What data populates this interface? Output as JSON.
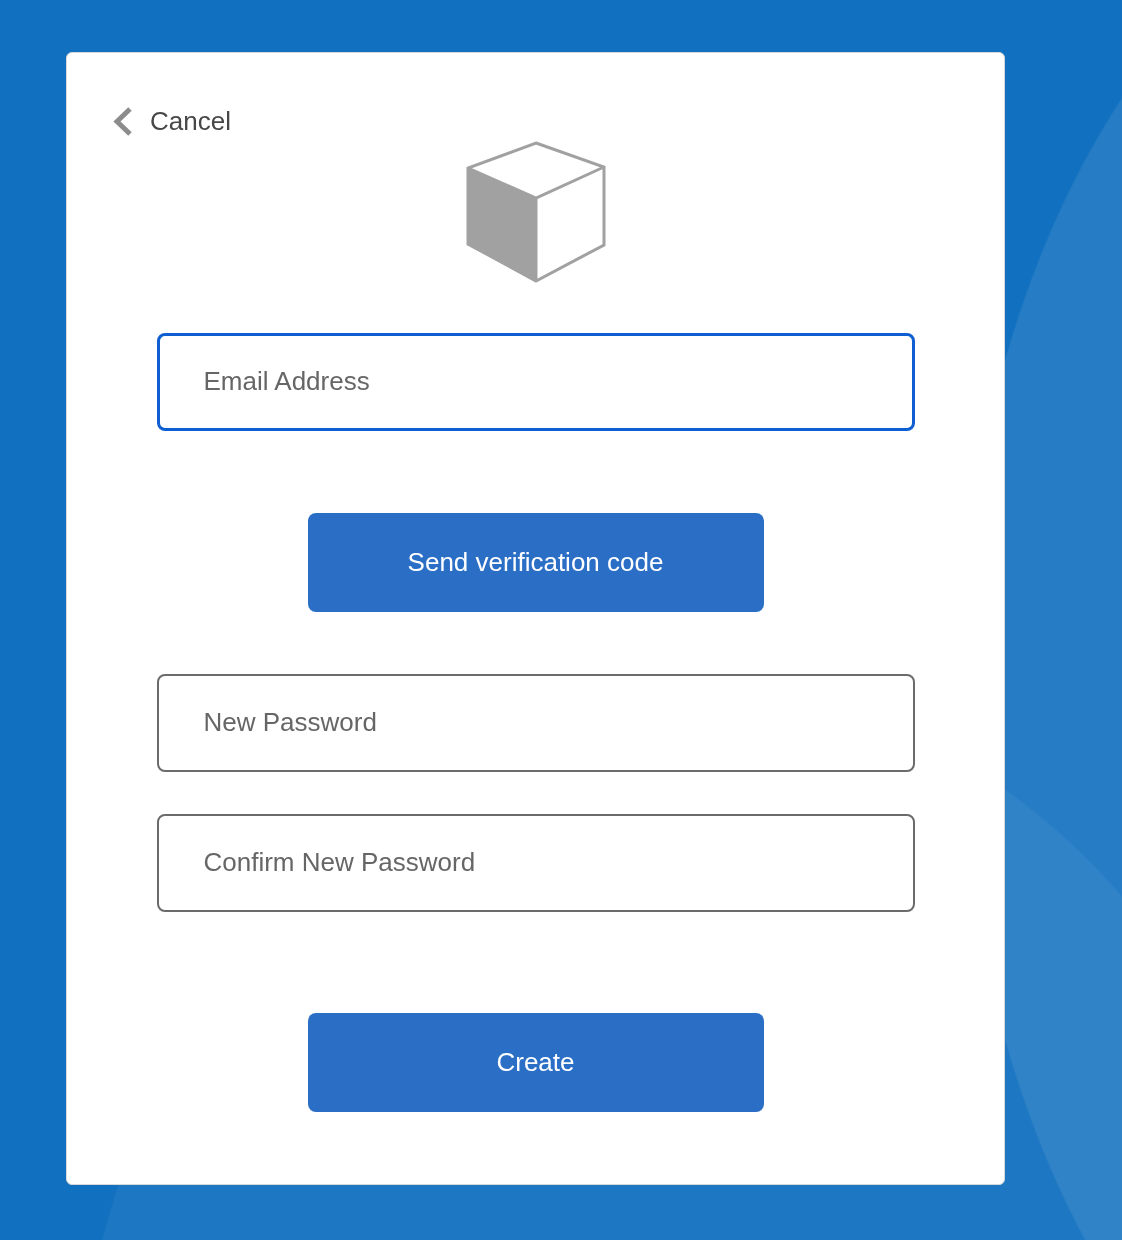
{
  "cancel_link": {
    "label": "Cancel"
  },
  "form": [
    {
      "kind": "field",
      "placeholder": "Email Address",
      "focused": true
    },
    {
      "kind": "button",
      "label": "Send verification code"
    },
    {
      "kind": "field",
      "placeholder": "New Password",
      "focused": false
    },
    {
      "kind": "field",
      "placeholder": "Confirm New Password",
      "focused": false
    },
    {
      "kind": "button",
      "label": "Create"
    }
  ]
}
